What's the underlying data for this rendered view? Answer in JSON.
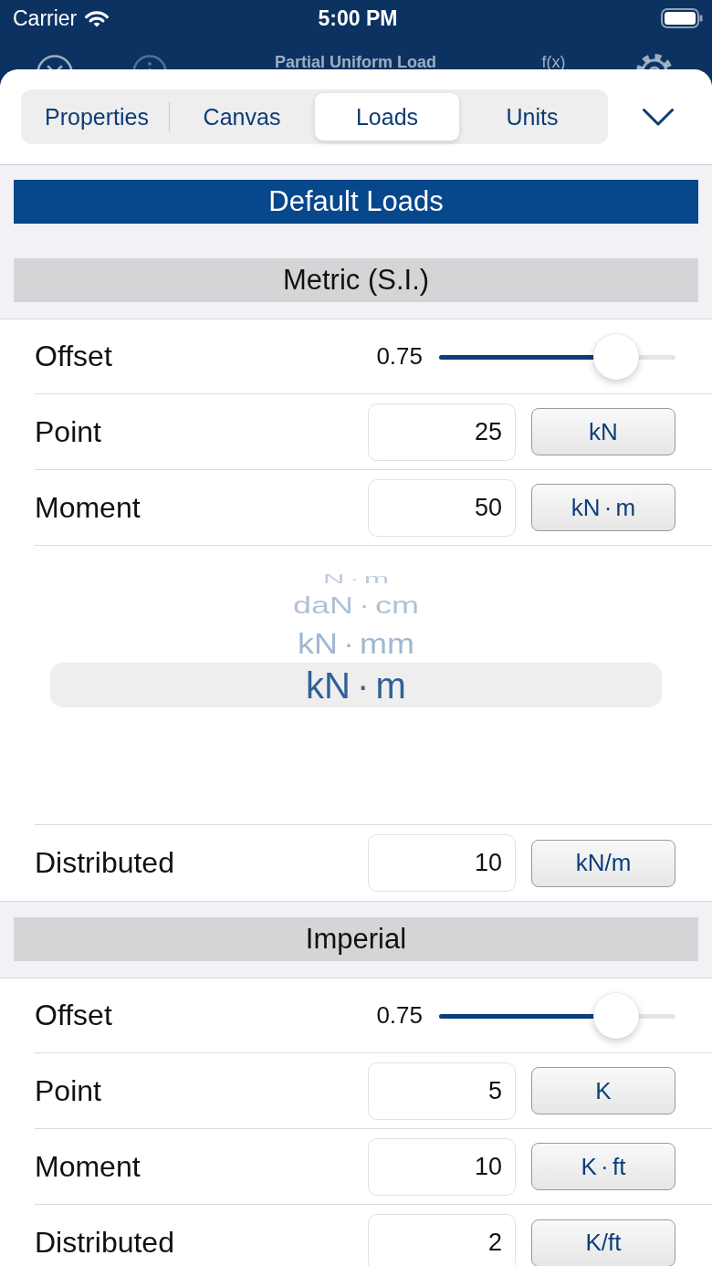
{
  "status_bar": {
    "carrier": "Carrier",
    "time": "5:00 PM"
  },
  "nav_bar": {
    "title": "Partial Uniform Load",
    "function_label": "f(x)"
  },
  "tabs": [
    {
      "label": "Properties",
      "selected": false
    },
    {
      "label": "Canvas",
      "selected": false
    },
    {
      "label": "Loads",
      "selected": true
    },
    {
      "label": "Units",
      "selected": false
    }
  ],
  "banner": {
    "title": "Default Loads"
  },
  "sections": [
    {
      "title": "Metric (S.I.)",
      "rows": [
        {
          "kind": "slider",
          "label": "Offset",
          "reading": "0.75",
          "level": 0.75
        },
        {
          "kind": "value",
          "label": "Point",
          "value": "25",
          "unit": "kN"
        },
        {
          "kind": "value",
          "label": "Moment",
          "value": "50",
          "unit": "kN · m"
        },
        {
          "kind": "picker",
          "options": [
            {
              "label": "N · m",
              "selected": false
            },
            {
              "label": "daN · cm",
              "selected": false
            },
            {
              "label": "kN · mm",
              "selected": false
            },
            {
              "label": "kN · m",
              "selected": true
            }
          ]
        },
        {
          "kind": "value",
          "label": "Distributed",
          "value": "10",
          "unit": "kN/m"
        }
      ]
    },
    {
      "title": "Imperial",
      "rows": [
        {
          "kind": "slider",
          "label": "Offset",
          "reading": "0.75",
          "level": 0.75
        },
        {
          "kind": "value",
          "label": "Point",
          "value": "5",
          "unit": "K"
        },
        {
          "kind": "value",
          "label": "Moment",
          "value": "10",
          "unit": "K · ft"
        },
        {
          "kind": "value",
          "label": "Distributed",
          "value": "2",
          "unit": "K/ft"
        }
      ]
    }
  ]
}
